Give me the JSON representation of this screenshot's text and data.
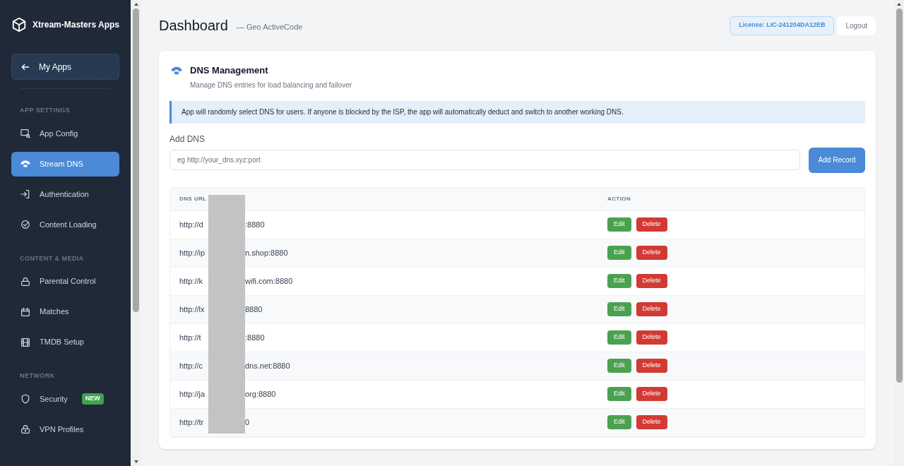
{
  "sidebar": {
    "brand": "Xtream-Masters Apps",
    "back_button": "My Apps",
    "sections": [
      {
        "heading": "APP SETTINGS",
        "items": [
          {
            "label": "App Config",
            "selected": false
          },
          {
            "label": "Stream DNS",
            "selected": true
          },
          {
            "label": "Authentication",
            "selected": false
          },
          {
            "label": "Content Loading",
            "selected": false
          }
        ]
      },
      {
        "heading": "CONTENT & MEDIA",
        "items": [
          {
            "label": "Parental Control",
            "selected": false
          },
          {
            "label": "Matches",
            "selected": false
          },
          {
            "label": "TMDB Setup",
            "selected": false
          }
        ]
      },
      {
        "heading": "NETWORK",
        "items": [
          {
            "label": "Security",
            "selected": false,
            "badge": "NEW"
          },
          {
            "label": "VPN Profiles",
            "selected": false
          }
        ]
      }
    ]
  },
  "header": {
    "title": "Dashboard",
    "subtitle": "— Geo ActiveCode",
    "license": "License: LIC-241204DA12EB",
    "logout": "Logout"
  },
  "card": {
    "title": "DNS Management",
    "description": "Manage DNS entries for load balancing and failover",
    "notice": "App will randomly select DNS for users. If anyone is blocked by the ISP, the app will automatically deduct and switch to another working DNS.",
    "add_label": "Add DNS",
    "input_placeholder": "eg http://your_dns.xyz:port",
    "add_button": "Add Record",
    "table": {
      "columns": [
        "DNS URL",
        "ACTION"
      ],
      "rows": [
        {
          "url_start": "http://d",
          "url_end": ":8880",
          "edit": "Edit",
          "delete": "Delete"
        },
        {
          "url_start": "http://ip",
          "url_end": "n.shop:8880",
          "edit": "Edit",
          "delete": "Delete"
        },
        {
          "url_start": "http://k",
          "url_end": "wifi.com:8880",
          "edit": "Edit",
          "delete": "Delete"
        },
        {
          "url_start": "http://lx",
          "url_end": "8880",
          "edit": "Edit",
          "delete": "Delete"
        },
        {
          "url_start": "http://t",
          "url_end": ":8880",
          "edit": "Edit",
          "delete": "Delete"
        },
        {
          "url_start": "http://c",
          "url_end": "dns.net:8880",
          "edit": "Edit",
          "delete": "Delete"
        },
        {
          "url_start": "http://ja",
          "url_end": "org:8880",
          "edit": "Edit",
          "delete": "Delete"
        },
        {
          "url_start": "http://tr",
          "url_end": "0",
          "edit": "Edit",
          "delete": "Delete"
        }
      ]
    }
  }
}
